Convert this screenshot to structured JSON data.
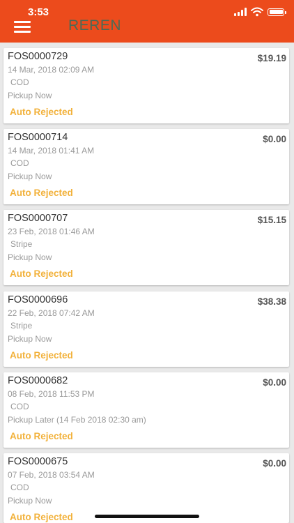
{
  "status_bar": {
    "time": "3:53"
  },
  "header": {
    "brand": "REREN"
  },
  "orders": [
    {
      "id": "FOS0000729",
      "amount": "$19.19",
      "date": "14 Mar, 2018 02:09 AM",
      "payment": "COD",
      "pickup": "Pickup Now",
      "status": "Auto Rejected"
    },
    {
      "id": "FOS0000714",
      "amount": "$0.00",
      "date": "14 Mar, 2018 01:41 AM",
      "payment": "COD",
      "pickup": "Pickup Now",
      "status": "Auto Rejected"
    },
    {
      "id": "FOS0000707",
      "amount": "$15.15",
      "date": "23 Feb, 2018 01:46 AM",
      "payment": "Stripe",
      "pickup": "Pickup Now",
      "status": "Auto Rejected"
    },
    {
      "id": "FOS0000696",
      "amount": "$38.38",
      "date": "22 Feb, 2018 07:42 AM",
      "payment": "Stripe",
      "pickup": "Pickup Now",
      "status": "Auto Rejected"
    },
    {
      "id": "FOS0000682",
      "amount": "$0.00",
      "date": "08 Feb, 2018 11:53 PM",
      "payment": "COD",
      "pickup": "Pickup Later (14 Feb 2018 02:30 am)",
      "status": "Auto Rejected"
    },
    {
      "id": "FOS0000675",
      "amount": "$0.00",
      "date": "07 Feb, 2018 03:54 AM",
      "payment": "COD",
      "pickup": "Pickup Now",
      "status": "Auto Rejected"
    }
  ],
  "colors": {
    "header": "#ec4b1c",
    "status": "#f2b13a",
    "brand_text": "#4a6a55"
  },
  "icons": {
    "menu": "hamburger-icon",
    "wifi": "wifi-icon",
    "battery": "battery-icon",
    "signal": "signal-icon"
  }
}
